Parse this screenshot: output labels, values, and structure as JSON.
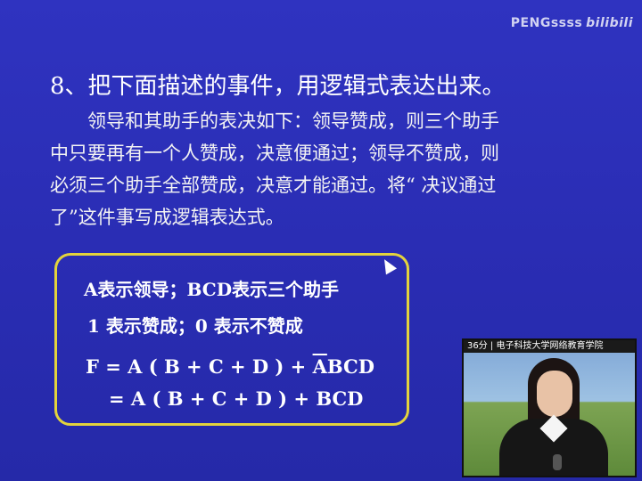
{
  "watermark": {
    "text": "PENGssss",
    "brand": "bilibili"
  },
  "title": "8、把下面描述的事件，用逻辑式表达出来。",
  "paragraph": [
    "领导和其助手的表决如下：领导赞成，则三个助手",
    "中只要再有一个人赞成，决意便通过；领导不赞成，则",
    "必须三个助手全部赞成，决意才能通过。将“ 决议通过",
    "了”这件事写成逻辑表达式。"
  ],
  "box": {
    "line1": "A表示领导；BCD表示三个助手",
    "line2": "1 表示赞成；0 表示不赞成",
    "formula1_prefix": "F = A ( B + C + D ) + ",
    "formula1_bar": "A",
    "formula1_suffix": "BCD",
    "formula2": "= A ( B + C + D ) + BCD"
  },
  "video": {
    "caption": "36分 | 电子科技大学网络教育学院"
  },
  "colors": {
    "background": "#2b2fb8",
    "box_border": "#e3d33c"
  }
}
